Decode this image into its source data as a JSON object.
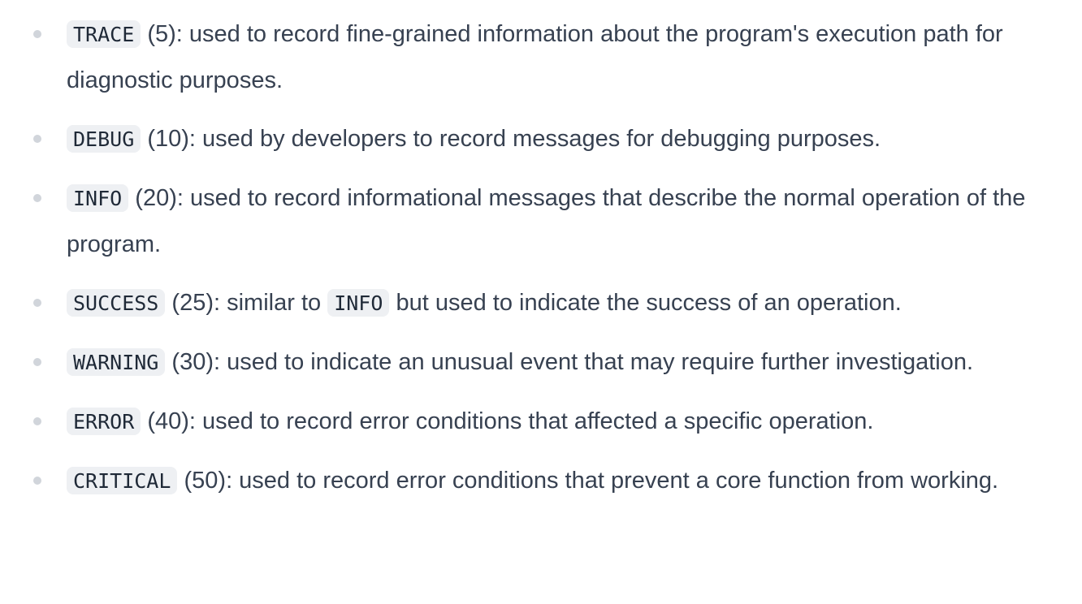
{
  "levels": [
    {
      "name": "TRACE",
      "value": "(5)",
      "description": ": used to record fine-grained information about the program's execution path for diagnostic purposes."
    },
    {
      "name": "DEBUG",
      "value": "(10)",
      "description": ": used by developers to record messages for debugging purposes."
    },
    {
      "name": "INFO",
      "value": "(20)",
      "description": ": used to record informational messages that describe the normal operation of the program."
    },
    {
      "name": "SUCCESS",
      "value": "(25)",
      "description_pre": ": similar to",
      "inline_code": "INFO",
      "description_post": "but used to indicate the success of an operation."
    },
    {
      "name": "WARNING",
      "value": "(30)",
      "description": ": used to indicate an unusual event that may require further investigation."
    },
    {
      "name": "ERROR",
      "value": "(40)",
      "description": ": used to record error conditions that affected a specific operation."
    },
    {
      "name": "CRITICAL",
      "value": "(50)",
      "description": ": used to record error conditions that prevent a core function from working."
    }
  ]
}
